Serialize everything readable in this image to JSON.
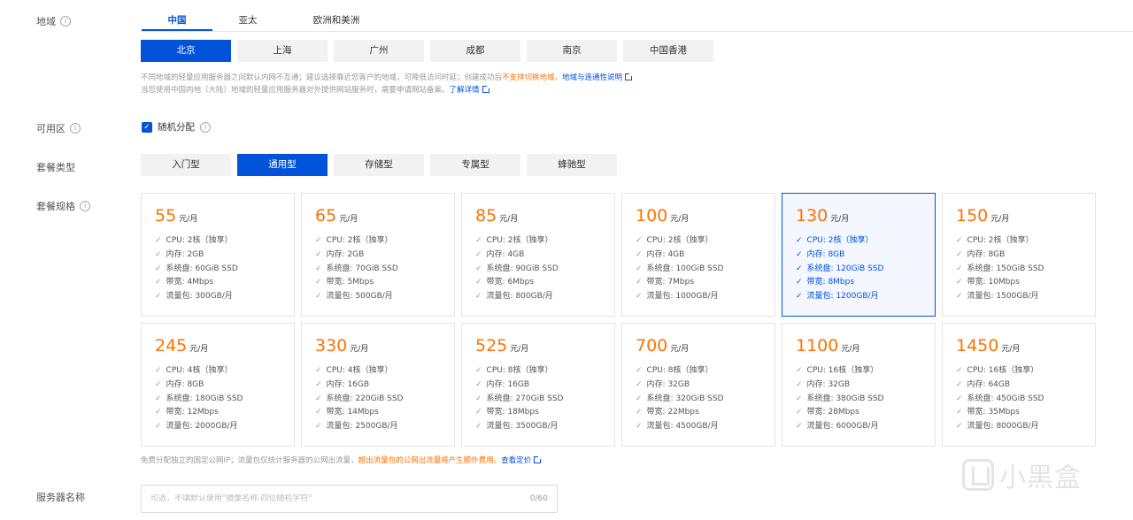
{
  "labels": {
    "region": "地域",
    "zone": "可用区",
    "package_type": "套餐类型",
    "package_spec": "套餐规格",
    "server_name": "服务器名称"
  },
  "region_tabs": [
    "中国",
    "亚太",
    "欧洲和美洲"
  ],
  "cities": [
    "北京",
    "上海",
    "广州",
    "成都",
    "南京",
    "中国香港"
  ],
  "region_note": {
    "line1_a": "不同地域的轻量应用服务器之间默认内网不互通；建议选择靠近您客户的地域，可降低访问时延；创建成功后",
    "line1_warn": "不支持切换地域",
    "line1_sep": "。",
    "line1_link": "地域与连通性说明",
    "line2_a": "当您使用中国内地（大陆）地域的轻量应用服务器对外提供网站服务时，需要申请网站备案。",
    "line2_link": "了解详情"
  },
  "zone": {
    "checked": true,
    "label": "随机分配"
  },
  "package_types": [
    "入门型",
    "通用型",
    "存储型",
    "专属型",
    "蜂驰型"
  ],
  "price_unit": "元/月",
  "plans": [
    {
      "price": "55",
      "cpu": "CPU: 2核（独享）",
      "mem": "内存: 2GB",
      "disk": "系统盘: 60GiB SSD",
      "bw": "带宽: 4Mbps",
      "traffic": "流量包: 300GB/月"
    },
    {
      "price": "65",
      "cpu": "CPU: 2核（独享）",
      "mem": "内存: 2GB",
      "disk": "系统盘: 70GiB SSD",
      "bw": "带宽: 5Mbps",
      "traffic": "流量包: 500GB/月"
    },
    {
      "price": "85",
      "cpu": "CPU: 2核（独享）",
      "mem": "内存: 4GB",
      "disk": "系统盘: 90GiB SSD",
      "bw": "带宽: 6Mbps",
      "traffic": "流量包: 800GB/月"
    },
    {
      "price": "100",
      "cpu": "CPU: 2核（独享）",
      "mem": "内存: 4GB",
      "disk": "系统盘: 100GiB SSD",
      "bw": "带宽: 7Mbps",
      "traffic": "流量包: 1000GB/月"
    },
    {
      "price": "130",
      "cpu": "CPU: 2核（独享）",
      "mem": "内存: 8GB",
      "disk": "系统盘: 120GiB SSD",
      "bw": "带宽: 8Mbps",
      "traffic": "流量包: 1200GB/月"
    },
    {
      "price": "150",
      "cpu": "CPU: 2核（独享）",
      "mem": "内存: 8GB",
      "disk": "系统盘: 150GiB SSD",
      "bw": "带宽: 10Mbps",
      "traffic": "流量包: 1500GB/月"
    },
    {
      "price": "245",
      "cpu": "CPU: 4核（独享）",
      "mem": "内存: 8GB",
      "disk": "系统盘: 180GiB SSD",
      "bw": "带宽: 12Mbps",
      "traffic": "流量包: 2000GB/月"
    },
    {
      "price": "330",
      "cpu": "CPU: 4核（独享）",
      "mem": "内存: 16GB",
      "disk": "系统盘: 220GiB SSD",
      "bw": "带宽: 14Mbps",
      "traffic": "流量包: 2500GB/月"
    },
    {
      "price": "525",
      "cpu": "CPU: 8核（独享）",
      "mem": "内存: 16GB",
      "disk": "系统盘: 270GiB SSD",
      "bw": "带宽: 18Mbps",
      "traffic": "流量包: 3500GB/月"
    },
    {
      "price": "700",
      "cpu": "CPU: 8核（独享）",
      "mem": "内存: 32GB",
      "disk": "系统盘: 320GiB SSD",
      "bw": "带宽: 22Mbps",
      "traffic": "流量包: 4500GB/月"
    },
    {
      "price": "1100",
      "cpu": "CPU: 16核（独享）",
      "mem": "内存: 32GB",
      "disk": "系统盘: 380GiB SSD",
      "bw": "带宽: 28Mbps",
      "traffic": "流量包: 6000GB/月"
    },
    {
      "price": "1450",
      "cpu": "CPU: 16核（独享）",
      "mem": "内存: 64GB",
      "disk": "系统盘: 450GiB SSD",
      "bw": "带宽: 35Mbps",
      "traffic": "流量包: 8000GB/月"
    }
  ],
  "plan_note": {
    "a": "免费分配独立的固定公网IP；流量包仅统计服务器的公网出流量，",
    "warn": "超出流量包的公网出流量将产生额外费用。",
    "link": "查看定价"
  },
  "server_name_input": {
    "placeholder": "可选，不填默认使用\"镜像名称-四位随机字符\"",
    "counter": "0/60"
  },
  "watermark": "小黑盒",
  "colors": {
    "accent": "#0052d9",
    "price": "#ff7200",
    "warn": "#ff7200"
  }
}
